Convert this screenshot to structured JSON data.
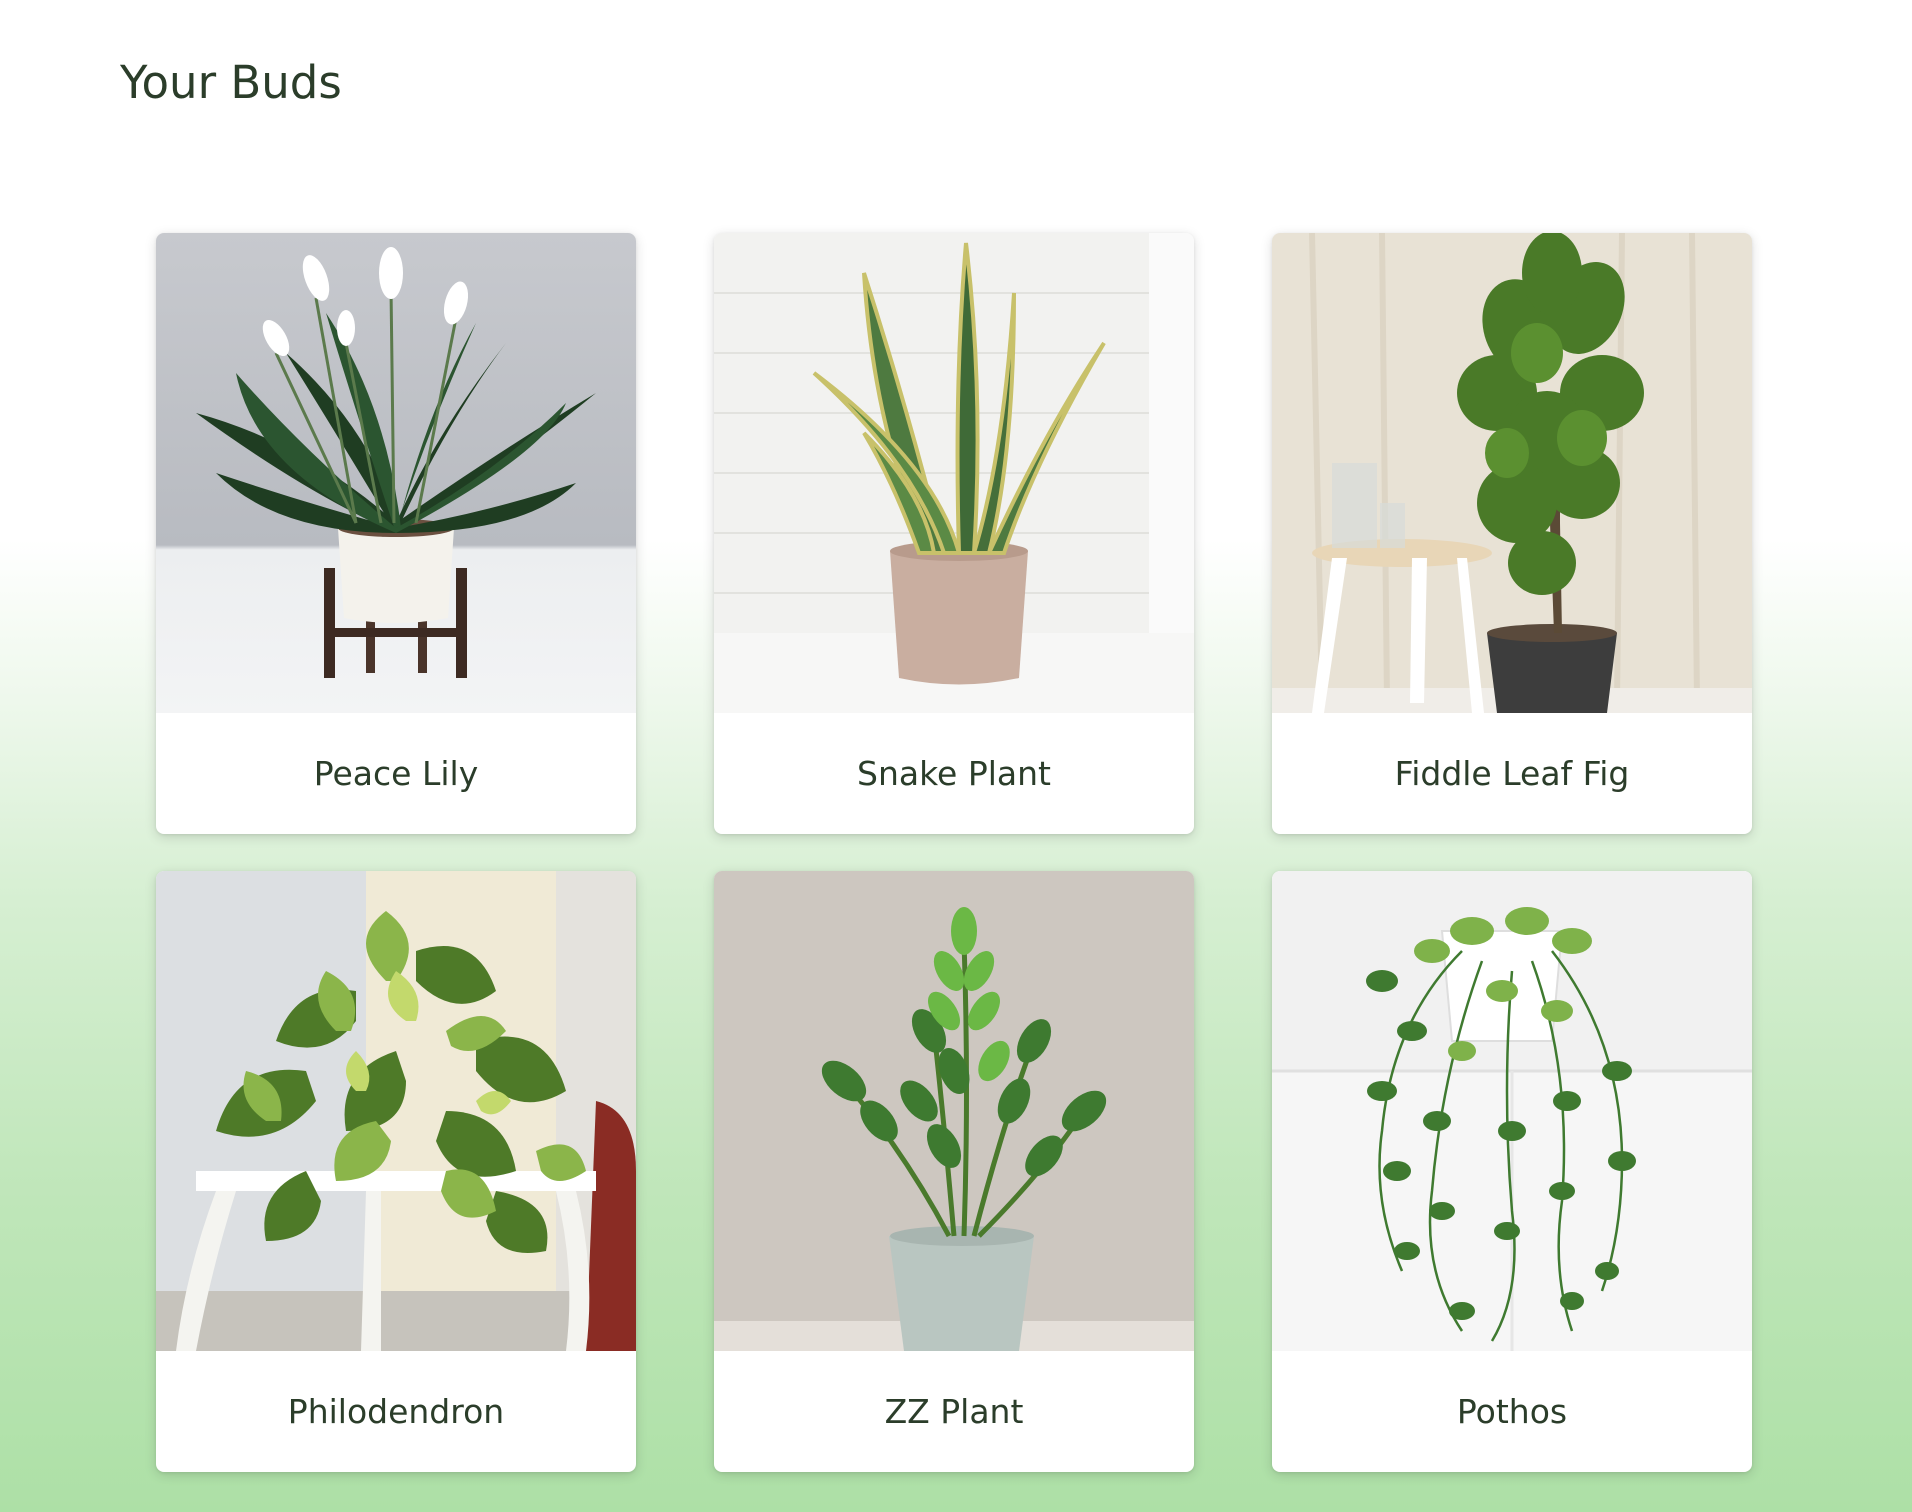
{
  "page": {
    "title": "Your Buds"
  },
  "plants": [
    {
      "name": "Peace Lily",
      "image": "peace-lily-photo"
    },
    {
      "name": "Snake Plant",
      "image": "snake-plant-photo"
    },
    {
      "name": "Fiddle Leaf Fig",
      "image": "fiddle-leaf-fig-photo"
    },
    {
      "name": "Philodendron",
      "image": "philodendron-photo"
    },
    {
      "name": "ZZ Plant",
      "image": "zz-plant-photo"
    },
    {
      "name": "Pothos",
      "image": "pothos-photo"
    }
  ],
  "colors": {
    "text": "#2b3d2a",
    "card_bg": "#ffffff",
    "gradient_bottom": "#ade0a6"
  }
}
